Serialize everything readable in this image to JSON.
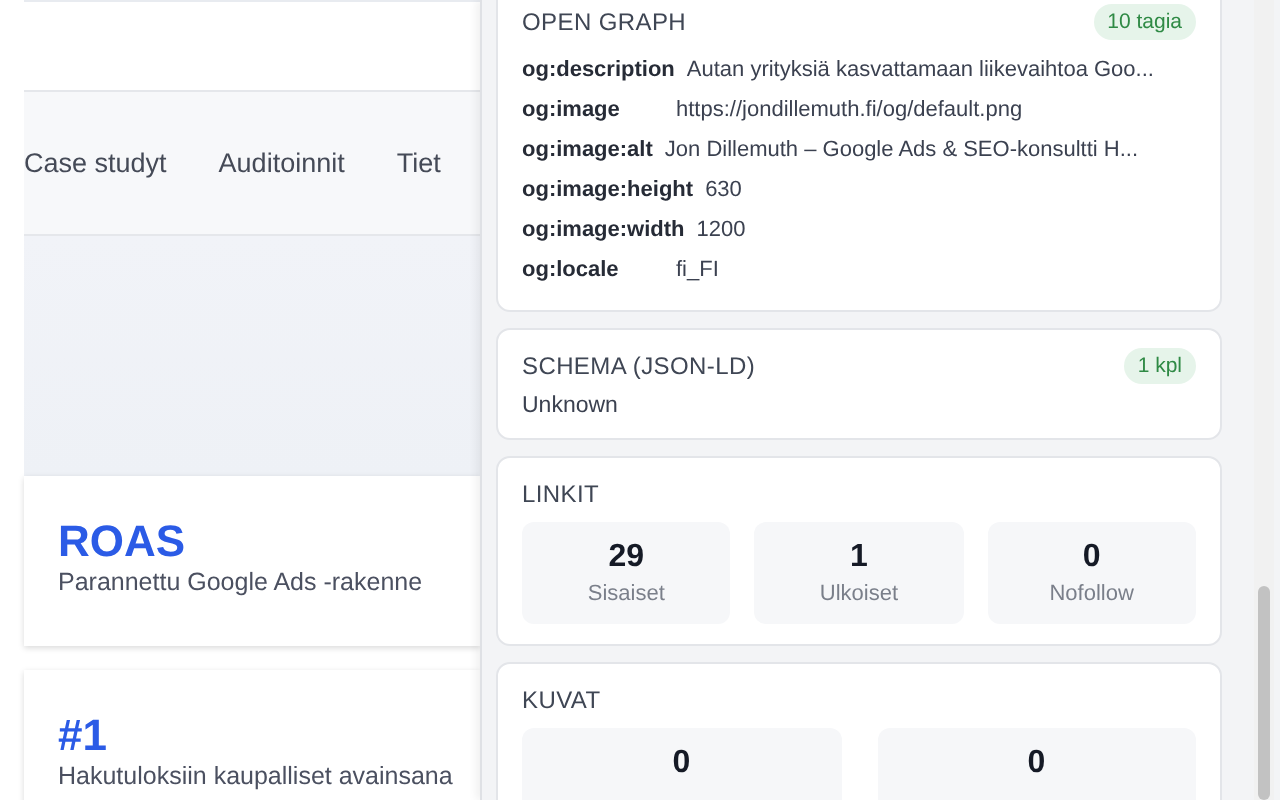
{
  "site": {
    "nav": [
      "Case studyt",
      "Auditoinnit",
      "Tiet"
    ],
    "cards": [
      {
        "value": "ROAS",
        "caption": "Parannettu Google Ads -rakenne"
      },
      {
        "value": "#1",
        "caption": "Hakutuloksiin kaupalliset avainsana"
      }
    ]
  },
  "panel": {
    "open_graph": {
      "title": "OPEN GRAPH",
      "badge": "10 tagia",
      "rows": [
        {
          "key": "og:description",
          "value": "Autan yrityksiä kasvattamaan liikevaihtoa Goo..."
        },
        {
          "key": "og:image",
          "value": "https://jondillemuth.fi/og/default.png"
        },
        {
          "key": "og:image:alt",
          "value": "Jon Dillemuth – Google Ads & SEO-konsultti H..."
        },
        {
          "key": "og:image:height",
          "value": "630"
        },
        {
          "key": "og:image:width",
          "value": "1200"
        },
        {
          "key": "og:locale",
          "value": "fi_FI"
        }
      ]
    },
    "schema": {
      "title": "SCHEMA (JSON-LD)",
      "badge": "1 kpl",
      "text": "Unknown"
    },
    "links": {
      "title": "LINKIT",
      "stats": [
        {
          "value": "29",
          "label": "Sisaiset"
        },
        {
          "value": "1",
          "label": "Ulkoiset"
        },
        {
          "value": "0",
          "label": "Nofollow"
        }
      ]
    },
    "images": {
      "title": "KUVAT",
      "stats": [
        {
          "value": "0"
        },
        {
          "value": "0"
        }
      ]
    }
  }
}
